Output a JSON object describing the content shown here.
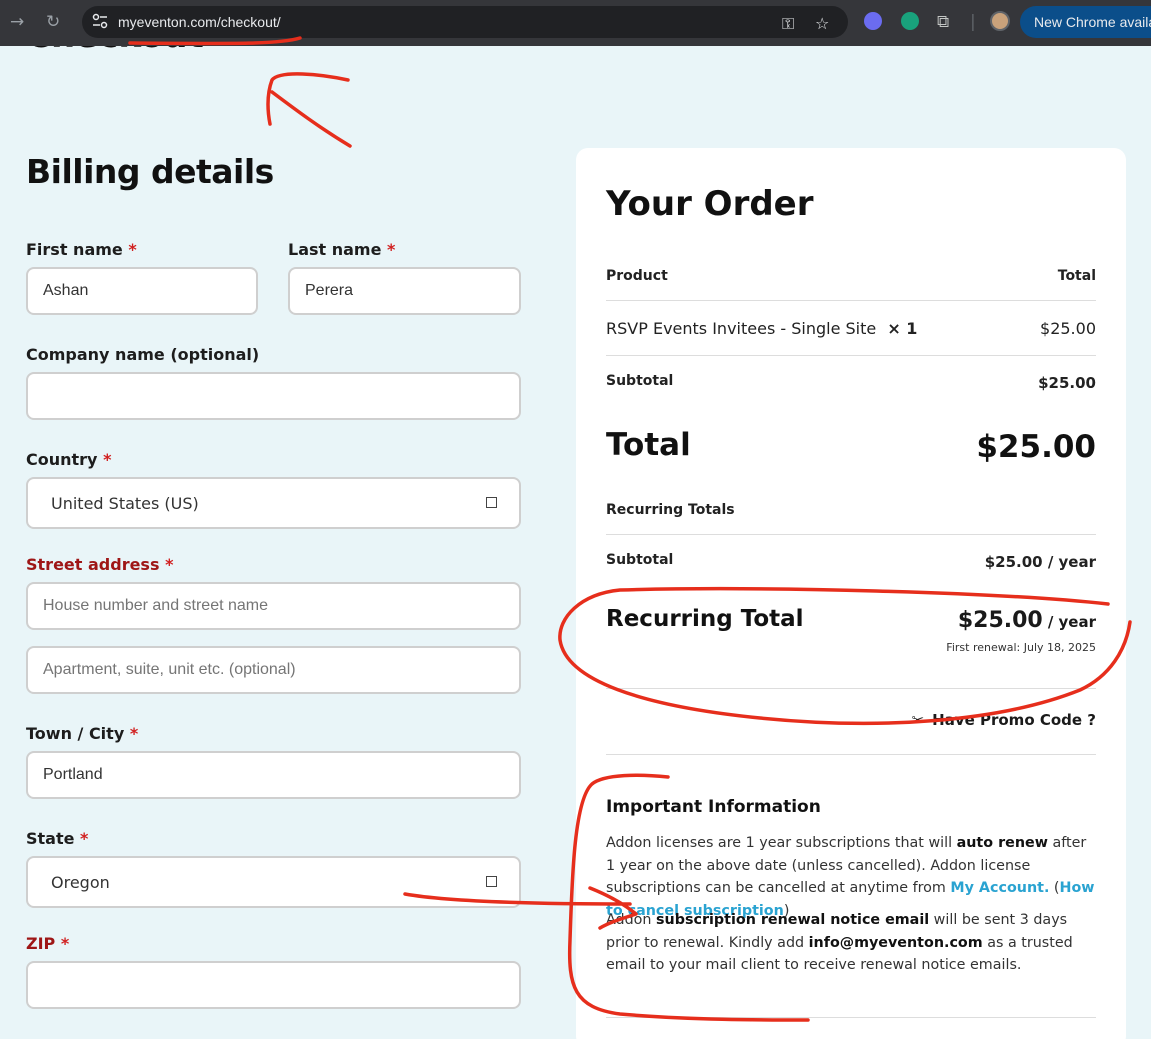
{
  "browser": {
    "url": "myeventon.com/checkout/",
    "update_label": "New Chrome availa"
  },
  "page": {
    "title": "Checkout"
  },
  "billing": {
    "heading": "Billing details",
    "first_name": {
      "label": "First name",
      "required": "*",
      "value": "Ashan"
    },
    "last_name": {
      "label": "Last name",
      "required": "*",
      "value": "Perera"
    },
    "company": {
      "label": "Company name (optional)",
      "value": ""
    },
    "country": {
      "label": "Country",
      "required": "*",
      "value": "United States (US)"
    },
    "street": {
      "label": "Street address",
      "required": "*",
      "placeholder1": "House number and street name",
      "placeholder2": "Apartment, suite, unit etc. (optional)"
    },
    "city": {
      "label": "Town / City",
      "required": "*",
      "value": "Portland"
    },
    "state": {
      "label": "State",
      "required": "*",
      "value": "Oregon"
    },
    "zip": {
      "label": "ZIP",
      "required": "*",
      "value": ""
    }
  },
  "order": {
    "title": "Your Order",
    "col_product": "Product",
    "col_total": "Total",
    "item_name": "RSVP Events Invitees - Single Site",
    "item_qty": "× 1",
    "item_price": "$25.00",
    "subtotal_label": "Subtotal",
    "subtotal_value": "$25.00",
    "total_label": "Total",
    "total_value": "$25.00",
    "recurring_heading": "Recurring Totals",
    "rec_subtotal_label": "Subtotal",
    "rec_subtotal_value": "$25.00 / year",
    "rec_total_label": "Recurring Total",
    "rec_total_amount": "$25.00",
    "rec_total_period": "/ year",
    "first_renewal": "First renewal: July 18, 2025",
    "promo": "Have Promo Code ?"
  },
  "info": {
    "title": "Important Information",
    "p1": {
      "t1": "Addon licenses are 1 year subscriptions that will ",
      "b1": "auto renew",
      "t2": " after 1 year on the above date (unless cancelled). Addon license subscriptions can be cancelled at anytime from ",
      "link1": "My Account.",
      "t3": " (",
      "link2": "How to cancel subscription",
      "t4": ")"
    },
    "p2": {
      "t1": "Addon ",
      "b1": "subscription renewal notice email",
      "t2": " will be sent 3 days prior to renewal. Kindly add ",
      "b2": "info@myeventon.com",
      "t3": " as a trusted email to your mail client to receive renewal notice emails."
    }
  },
  "colors": {
    "annotation": "#e62e1c",
    "link": "#2aa3d1",
    "required": "#d12020"
  }
}
